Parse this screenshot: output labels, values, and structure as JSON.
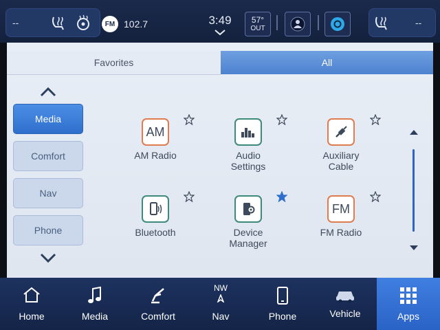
{
  "topbar": {
    "left_fan": "--",
    "right_fan": "--",
    "radio_band": "FM",
    "radio_freq": "102.7",
    "time": "3:49",
    "temperature": "57°",
    "temperature_label": "OUT"
  },
  "tabs": [
    {
      "label": "Favorites",
      "active": false
    },
    {
      "label": "All",
      "active": true
    }
  ],
  "categories": [
    {
      "label": "Media",
      "active": true
    },
    {
      "label": "Comfort",
      "active": false
    },
    {
      "label": "Nav",
      "active": false
    },
    {
      "label": "Phone",
      "active": false
    }
  ],
  "apps": [
    {
      "label_line1": "AM Radio",
      "label_line2": "",
      "icon_text": "AM",
      "icon": "am-radio-icon",
      "favorited": false
    },
    {
      "label_line1": "Audio",
      "label_line2": "Settings",
      "icon_text": "",
      "icon": "equalizer-icon",
      "favorited": false
    },
    {
      "label_line1": "Auxiliary",
      "label_line2": "Cable",
      "icon_text": "",
      "icon": "aux-cable-icon",
      "favorited": false
    },
    {
      "label_line1": "Bluetooth",
      "label_line2": "",
      "icon_text": "",
      "icon": "bluetooth-phone-icon",
      "favorited": false
    },
    {
      "label_line1": "Device",
      "label_line2": "Manager",
      "icon_text": "",
      "icon": "device-gear-icon",
      "favorited": true
    },
    {
      "label_line1": "FM Radio",
      "label_line2": "",
      "icon_text": "FM",
      "icon": "fm-radio-icon",
      "favorited": false
    }
  ],
  "nav": [
    {
      "label": "Home",
      "icon": "home-icon"
    },
    {
      "label": "Media",
      "icon": "music-note-icon"
    },
    {
      "label": "Comfort",
      "icon": "seat-icon"
    },
    {
      "label": "Nav",
      "icon": "compass-icon",
      "heading": "NW"
    },
    {
      "label": "Phone",
      "icon": "phone-icon"
    },
    {
      "label": "Vehicle",
      "icon": "car-icon"
    },
    {
      "label": "Apps",
      "icon": "grid-icon",
      "active": true
    }
  ],
  "colors": {
    "accent_blue": "#3a78d8",
    "app_icon_orange": "#e07a4f",
    "app_icon_teal": "#3e8a7a",
    "favorite_star": "#2f6fcc"
  }
}
